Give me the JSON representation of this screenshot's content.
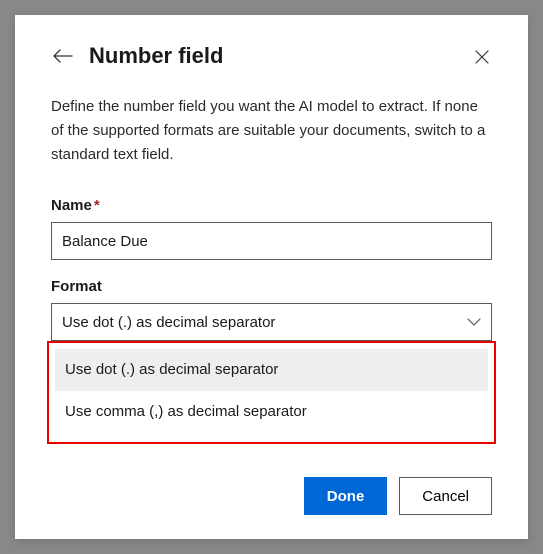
{
  "panel": {
    "title": "Number field",
    "description": "Define the number field you want the AI model to extract. If none of the supported formats are suitable your documents, switch to a standard text field."
  },
  "fields": {
    "name": {
      "label": "Name",
      "value": "Balance Due"
    },
    "format": {
      "label": "Format",
      "selected": "Use dot (.) as decimal separator",
      "options": [
        "Use dot (.) as decimal separator",
        "Use comma (,) as decimal separator"
      ]
    }
  },
  "buttons": {
    "done": "Done",
    "cancel": "Cancel"
  }
}
